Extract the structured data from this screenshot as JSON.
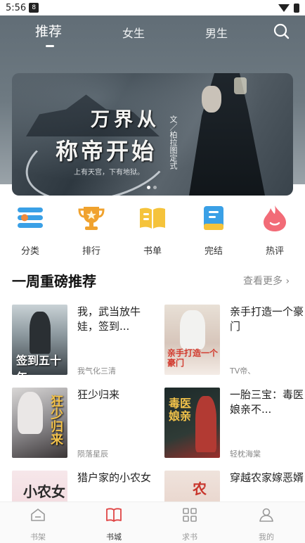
{
  "status_bar": {
    "time": "5:56",
    "app_badge": "8"
  },
  "top_tabs": [
    {
      "label": "推荐",
      "active": true
    },
    {
      "label": "女生",
      "active": false
    },
    {
      "label": "男生",
      "active": false
    }
  ],
  "banner": {
    "title_line1": "万界从",
    "title_line2": "称帝开始",
    "subtitle": "上有天宫，下有地狱。",
    "author": "文／柏拉图定式",
    "slide_count": 2,
    "active_slide": 1
  },
  "categories": [
    {
      "label": "分类",
      "icon": "list-icon"
    },
    {
      "label": "排行",
      "icon": "trophy-icon"
    },
    {
      "label": "书单",
      "icon": "open-book-icon"
    },
    {
      "label": "完结",
      "icon": "book-icon"
    },
    {
      "label": "热评",
      "icon": "flame-icon"
    }
  ],
  "section": {
    "title": "一周重磅推荐",
    "more_label": "查看更多"
  },
  "books": [
    {
      "title": "我，武当放牛娃，签到...",
      "author": "我气化三清",
      "cover_text": "签到五十年"
    },
    {
      "title": "亲手打造一个豪门",
      "author": "TV帝、",
      "cover_text": "亲手打造一个豪门"
    },
    {
      "title": "狂少归来",
      "author": "陨落星辰",
      "cover_text": "狂少归来"
    },
    {
      "title": "一胎三宝：毒医娘亲不...",
      "author": "轻枕海棠",
      "cover_text": "毒医娘亲"
    },
    {
      "title": "猎户家的小农女",
      "author": "",
      "cover_text": "小农女"
    },
    {
      "title": "穿越农家嫁恶婿",
      "author": "",
      "cover_text": "农家"
    }
  ],
  "bottom_nav": [
    {
      "label": "书架",
      "icon": "bookshelf-icon",
      "active": false
    },
    {
      "label": "书城",
      "icon": "book-city-icon",
      "active": true
    },
    {
      "label": "求书",
      "icon": "grid-icon",
      "active": false
    },
    {
      "label": "我的",
      "icon": "user-icon",
      "active": false
    }
  ],
  "colors": {
    "accent": "#e04545",
    "icon_blue": "#3aa0e6",
    "icon_orange": "#f0a22e",
    "icon_yellow": "#f5c33b",
    "icon_pink": "#f26b77"
  }
}
